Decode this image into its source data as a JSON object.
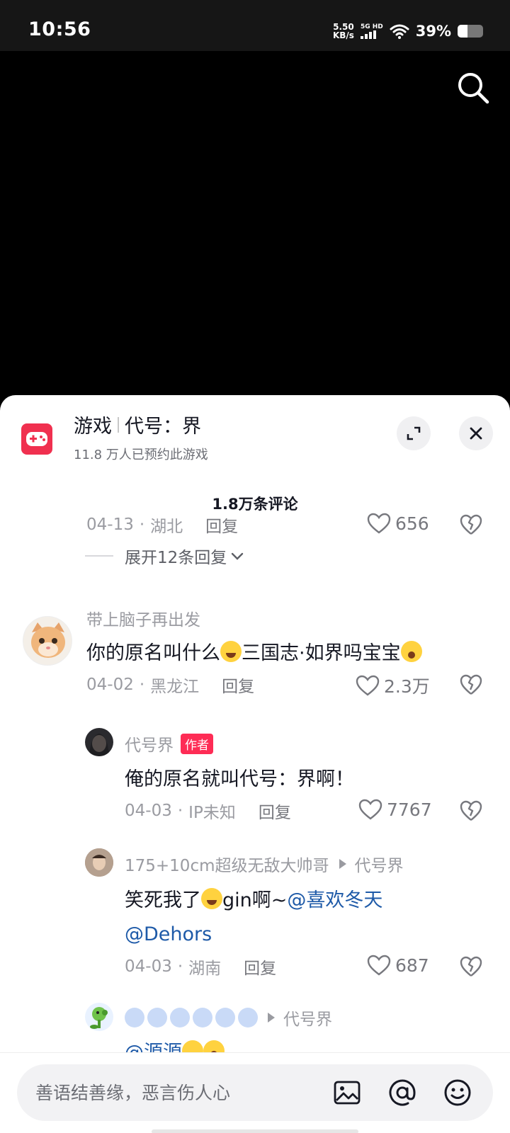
{
  "status_bar": {
    "time": "10:56",
    "net_speed_value": "5.50",
    "net_speed_unit": "KB/s",
    "network_label": "5G HD",
    "battery_percent": "39%",
    "battery_level": 0.39
  },
  "game": {
    "category": "游戏",
    "name": "代号：界",
    "subtitle": "11.8 万人已预约此游戏"
  },
  "comments_header": {
    "count": "1.8万条评论"
  },
  "prev_comment": {
    "date": "04-13",
    "location": "湖北",
    "reply": "回复",
    "likes": "656"
  },
  "expand": {
    "label": "展开12条回复"
  },
  "comments": [
    {
      "username": "带上脑子再出发",
      "text_a": "你的原名叫什么",
      "text_b": "三国志·如界吗宝宝",
      "date": "04-02",
      "location": "黑龙江",
      "reply": "回复",
      "likes": "2.3万"
    }
  ],
  "replies": [
    {
      "username": "代号界",
      "badge": "作者",
      "text": "俺的原名就叫代号：界啊！",
      "date": "04-03",
      "location": "IP未知",
      "reply": "回复",
      "likes": "7767"
    },
    {
      "username": "175+10cm超级无敌大帅哥",
      "reply_to": "代号界",
      "text_a": "笑死我了",
      "text_b": "gin啊~",
      "mention1": "@喜欢冬天",
      "mention2": "@Dehors",
      "date": "04-03",
      "location": "湖南",
      "reply": "回复",
      "likes": "687"
    },
    {
      "reply_to": "代号界",
      "mention": "@源源"
    }
  ],
  "input": {
    "placeholder": "善语结善缘，恶言伤人心"
  },
  "colors": {
    "accent": "#fe2c55",
    "mention": "#1e5aa8",
    "game_icon": "#f0304f"
  }
}
